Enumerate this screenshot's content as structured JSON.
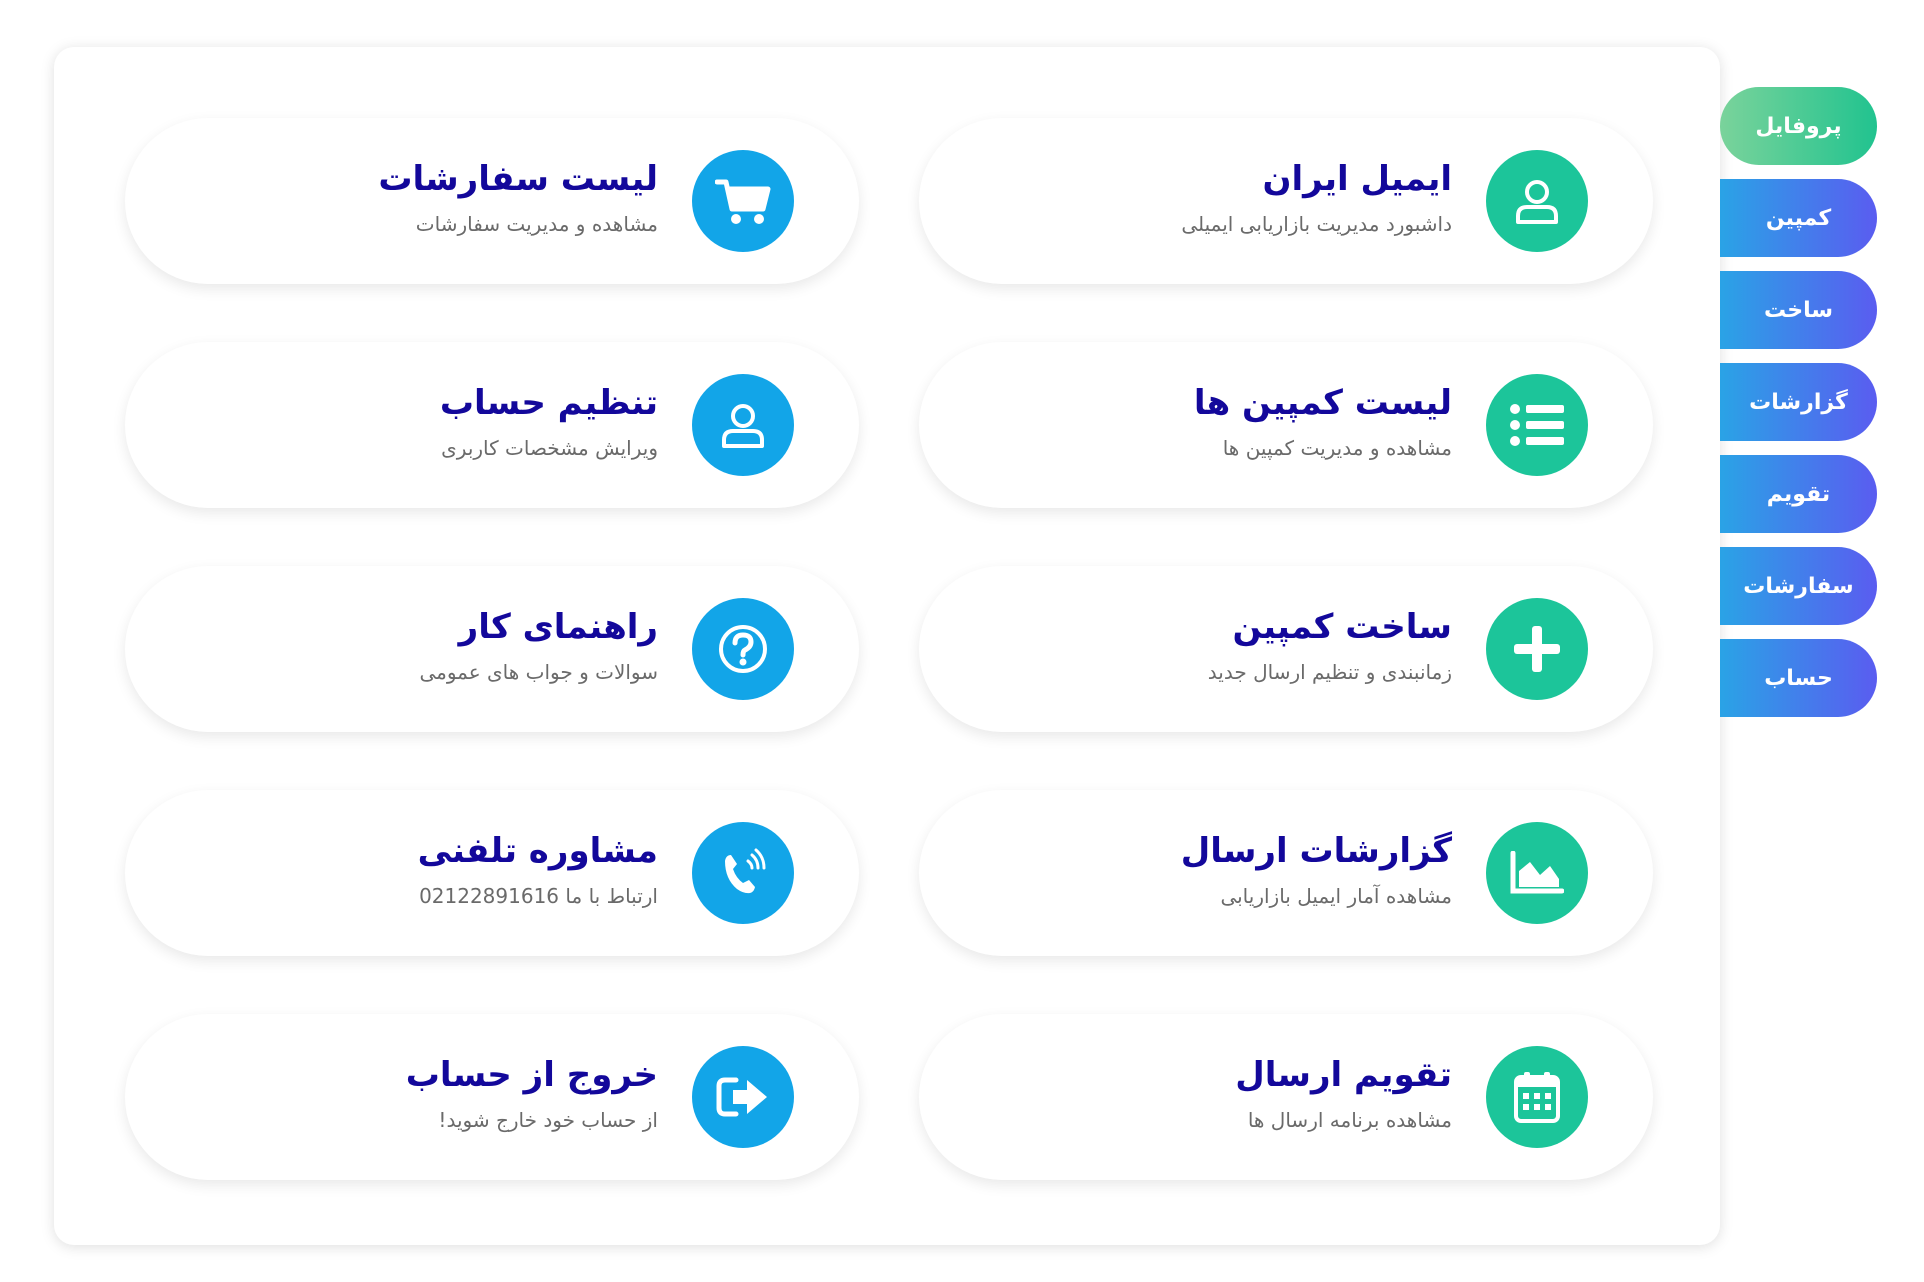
{
  "colors": {
    "title": "#13089b",
    "subtitle": "#6a6a6a",
    "green_icon": "#1cc59a",
    "blue_icon": "#12a5e8",
    "tab_gradient_start": "#2aa3e6",
    "tab_gradient_end": "#5a5cf0",
    "tab_active_start": "#7ad39b",
    "tab_active_end": "#21c38f"
  },
  "sidebar": {
    "tabs": [
      {
        "label": "پروفایل",
        "active": true
      },
      {
        "label": "کمپین",
        "active": false
      },
      {
        "label": "ساخت",
        "active": false
      },
      {
        "label": "گزارشات",
        "active": false
      },
      {
        "label": "تقویم",
        "active": false
      },
      {
        "label": "سفارشات",
        "active": false
      },
      {
        "label": "حساب",
        "active": false
      }
    ]
  },
  "cards": [
    {
      "title": "ایمیل ایران",
      "subtitle": "داشبورد مدیریت بازاریابی ایمیلی",
      "icon": "user-icon",
      "color": "green"
    },
    {
      "title": "لیست سفارشات",
      "subtitle": "مشاهده و مدیریت سفارشات",
      "icon": "shopping-cart-icon",
      "color": "blue"
    },
    {
      "title": "لیست کمپین ها",
      "subtitle": "مشاهده و مدیریت کمپین ها",
      "icon": "list-icon",
      "color": "green"
    },
    {
      "title": "تنظیم حساب",
      "subtitle": "ویرایش مشخصات کاربری",
      "icon": "user-icon",
      "color": "blue"
    },
    {
      "title": "ساخت کمپین",
      "subtitle": "زمانبندی و تنظیم ارسال جدید",
      "icon": "plus-icon",
      "color": "green"
    },
    {
      "title": "راهنمای کار",
      "subtitle": "سوالات و جواب های عمومی",
      "icon": "question-icon",
      "color": "blue"
    },
    {
      "title": "گزارشات ارسال",
      "subtitle": "مشاهده آمار ایمیل بازاریابی",
      "icon": "area-chart-icon",
      "color": "green"
    },
    {
      "title": "مشاوره تلفنی",
      "subtitle": "ارتباط با ما 02122891616",
      "icon": "phone-icon",
      "color": "blue"
    },
    {
      "title": "تقویم ارسال",
      "subtitle": "مشاهده برنامه ارسال ها",
      "icon": "calendar-icon",
      "color": "green"
    },
    {
      "title": "خروج از حساب",
      "subtitle": "از حساب خود خارج شوید!",
      "icon": "sign-out-icon",
      "color": "blue"
    }
  ]
}
